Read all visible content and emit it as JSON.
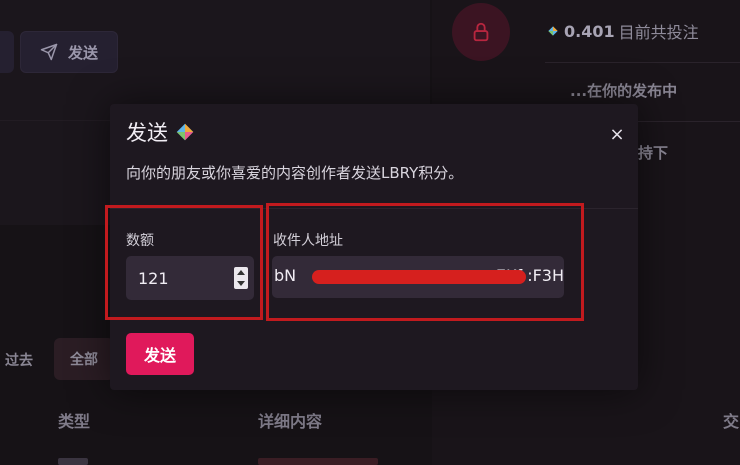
{
  "background": {
    "send_button_label": "发送",
    "balance_amount": "0.401",
    "balance_text": "目前共投注",
    "publishing_text": "...在你的发布中",
    "hold_text": "持下",
    "tabs": {
      "past": "过去",
      "all": "全部"
    },
    "table_headers": {
      "type": "类型",
      "detail": "详细内容",
      "tx": "交"
    }
  },
  "modal": {
    "title": "发送",
    "subtitle": "向你的朋友或你喜爱的内容创作者发送LBRY积分。",
    "close_glyph": "×",
    "amount": {
      "label": "数额",
      "value": "121"
    },
    "recipient": {
      "label": "收件人地址",
      "visible_start": "bN",
      "visible_end": "EKf  :F3H"
    },
    "submit_label": "发送"
  },
  "colors": {
    "accent": "#e0195b",
    "highlight": "#c21a1e",
    "modal_bg": "#1e1820",
    "input_bg": "#332a38"
  },
  "icons": [
    "send-icon",
    "lock-icon",
    "lbc-icon",
    "close-icon",
    "stepper-icon"
  ]
}
